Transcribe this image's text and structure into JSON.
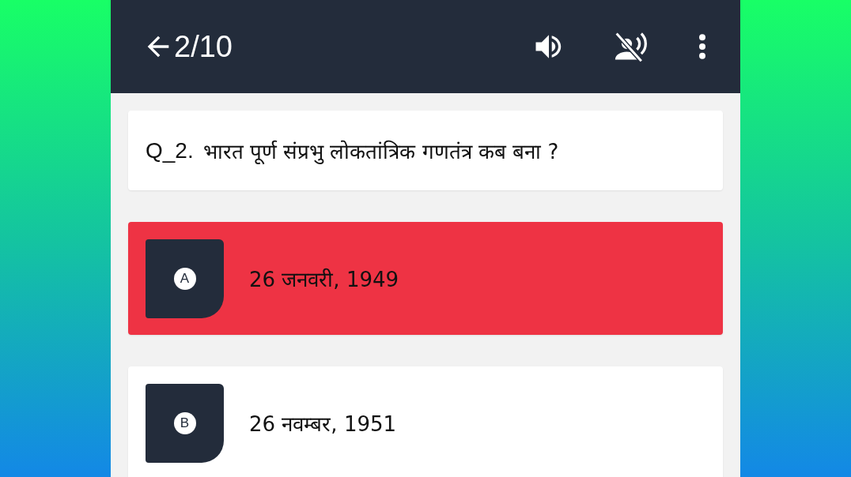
{
  "header": {
    "counter": "2/10"
  },
  "question": {
    "number": "Q_2.",
    "text": "भारत पूर्ण संप्रभु लोकतांत्रिक गणतंत्र कब बना ?"
  },
  "options": [
    {
      "letter": "A",
      "text": "26 जनवरी, 1949",
      "selected": true
    },
    {
      "letter": "B",
      "text": "26 नवम्बर, 1951",
      "selected": false
    }
  ]
}
